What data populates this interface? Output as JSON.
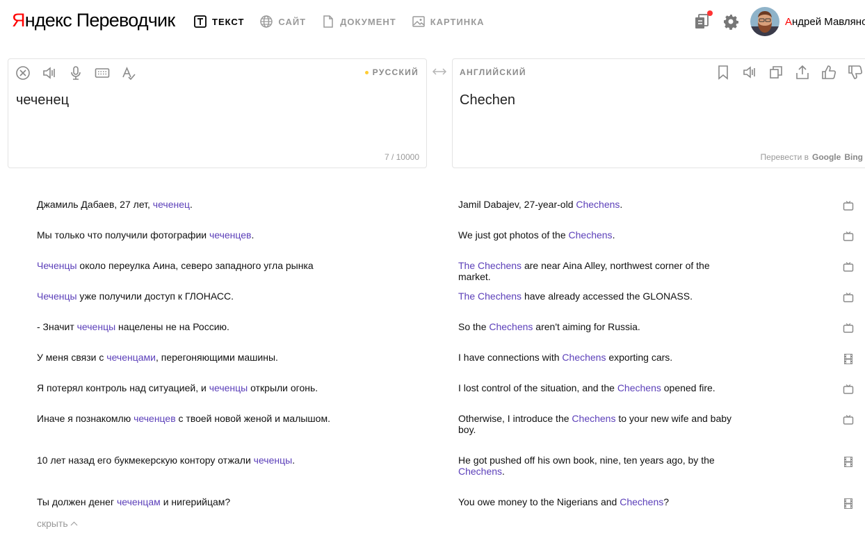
{
  "header": {
    "logo_brand_first": "Я",
    "logo_brand_rest": "ндекс",
    "logo_product": "Переводчик",
    "modes": [
      {
        "label": "ТЕКСТ",
        "icon": "text-mode-icon",
        "active": true
      },
      {
        "label": "САЙТ",
        "icon": "globe-icon",
        "active": false
      },
      {
        "label": "ДОКУМЕНТ",
        "icon": "document-icon",
        "active": false
      },
      {
        "label": "КАРТИНКА",
        "icon": "image-icon",
        "active": false
      }
    ],
    "user_first_letter": "А",
    "user_rest": "ндрей Мавлянов"
  },
  "source": {
    "language": "РУССКИЙ",
    "text": "чеченец",
    "counter": "7 / 10000"
  },
  "target": {
    "language": "АНГЛИЙСКИЙ",
    "text": "Chechen",
    "translate_in_label": "Перевести в",
    "engines": [
      "Google",
      "Bing"
    ]
  },
  "examples": [
    {
      "src": [
        [
          "Джамиль Дабаев, 27 лет, ",
          false
        ],
        [
          "чеченец",
          true
        ],
        [
          ".",
          false
        ]
      ],
      "tgt": [
        [
          "Jamil Dabajev, 27-year-old ",
          false
        ],
        [
          "Chechens",
          true
        ],
        [
          ".",
          false
        ]
      ],
      "icon": "tv-icon"
    },
    {
      "src": [
        [
          "Мы только что получили фотографии ",
          false
        ],
        [
          "чеченцев",
          true
        ],
        [
          ".",
          false
        ]
      ],
      "tgt": [
        [
          "We just got photos of the ",
          false
        ],
        [
          "Chechens",
          true
        ],
        [
          ".",
          false
        ]
      ],
      "icon": "tv-icon"
    },
    {
      "src": [
        [
          "Чеченцы",
          true
        ],
        [
          " около переулка Аина, северо западного угла рынка",
          false
        ]
      ],
      "tgt": [
        [
          "The Chechens",
          true
        ],
        [
          " are near Aina Alley, northwest corner of the market.",
          false
        ]
      ],
      "icon": "tv-icon"
    },
    {
      "src": [
        [
          "Чеченцы",
          true
        ],
        [
          " уже получили доступ к ГЛОНАСС.",
          false
        ]
      ],
      "tgt": [
        [
          "The Chechens",
          true
        ],
        [
          " have already accessed the GLONASS.",
          false
        ]
      ],
      "icon": "tv-icon"
    },
    {
      "src": [
        [
          "- Значит ",
          false
        ],
        [
          "чеченцы",
          true
        ],
        [
          " нацелены не на Россию.",
          false
        ]
      ],
      "tgt": [
        [
          "So the ",
          false
        ],
        [
          "Chechens",
          true
        ],
        [
          " aren't aiming for Russia.",
          false
        ]
      ],
      "icon": "tv-icon"
    },
    {
      "src": [
        [
          "У меня связи с ",
          false
        ],
        [
          "чеченцами",
          true
        ],
        [
          ", перегоняющими машины.",
          false
        ]
      ],
      "tgt": [
        [
          "I have connections with ",
          false
        ],
        [
          "Chechens",
          true
        ],
        [
          " exporting cars.",
          false
        ]
      ],
      "icon": "film-icon"
    },
    {
      "src": [
        [
          "Я потерял контроль над ситуацией, и ",
          false
        ],
        [
          "чеченцы",
          true
        ],
        [
          " открыли огонь.",
          false
        ]
      ],
      "tgt": [
        [
          "I lost control of the situation, and the ",
          false
        ],
        [
          "Chechens",
          true
        ],
        [
          " opened fire.",
          false
        ]
      ],
      "icon": "tv-icon"
    },
    {
      "src": [
        [
          "Иначе я познакомлю ",
          false
        ],
        [
          "чеченцев",
          true
        ],
        [
          " с твоей новой женой и малышом.",
          false
        ]
      ],
      "tgt": [
        [
          "Otherwise, I introduce the ",
          false
        ],
        [
          "Chechens",
          true
        ],
        [
          " to your new wife and baby boy.",
          false
        ]
      ],
      "icon": "tv-icon"
    },
    {
      "src": [
        [
          "10 лет назад его букмекерскую контору отжали ",
          false
        ],
        [
          "чеченцы",
          true
        ],
        [
          ".",
          false
        ]
      ],
      "tgt": [
        [
          "He got pushed off his own book, nine, ten years ago, by the ",
          false
        ],
        [
          "Chechens",
          true
        ],
        [
          ".",
          false
        ]
      ],
      "icon": "film-icon"
    },
    {
      "src": [
        [
          "Ты должен денег ",
          false
        ],
        [
          "чеченцам",
          true
        ],
        [
          " и нигерийцам?",
          false
        ]
      ],
      "tgt": [
        [
          "You owe money to the Nigerians and ",
          false
        ],
        [
          "Chechens",
          true
        ],
        [
          "?",
          false
        ]
      ],
      "icon": "film-icon"
    }
  ],
  "hide_label": "скрыть",
  "colors": {
    "accent_link": "#5b3fb9",
    "brand_red": "#ff0000",
    "notify_dot": "#ff3333"
  }
}
